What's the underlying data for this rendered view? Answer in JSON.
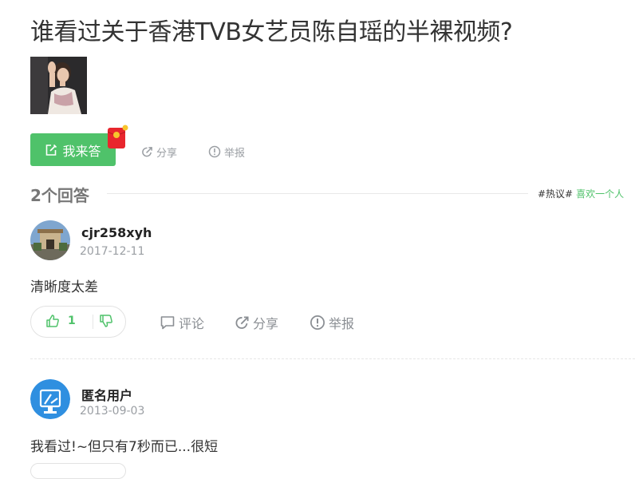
{
  "question": {
    "title": "谁看过关于香港TVB女艺员陈自瑶的半裸视频?",
    "answer_button": "我来答",
    "share_label": "分享",
    "report_label": "举报"
  },
  "answers_header": {
    "count_label": "2个回答",
    "hot_tag": "#热议#",
    "hot_text": "喜欢一个人"
  },
  "answers": [
    {
      "username": "cjr258xyh",
      "date": "2017-12-11",
      "text": "清晰度太差",
      "likes": "1",
      "comment_label": "评论",
      "share_label": "分享",
      "report_label": "举报"
    },
    {
      "username": "匿名用户",
      "date": "2013-09-03",
      "text": "我看过!~但只有7秒而已...很短"
    }
  ],
  "colors": {
    "accent": "#4fc26a",
    "muted": "#9a9ea3",
    "red_packet": "#e8262d"
  },
  "icons": [
    "edit-icon",
    "red-packet-icon",
    "share-icon",
    "report-icon",
    "thumbs-up-icon",
    "thumbs-down-icon",
    "comment-icon",
    "anonymous-avatar-icon"
  ]
}
